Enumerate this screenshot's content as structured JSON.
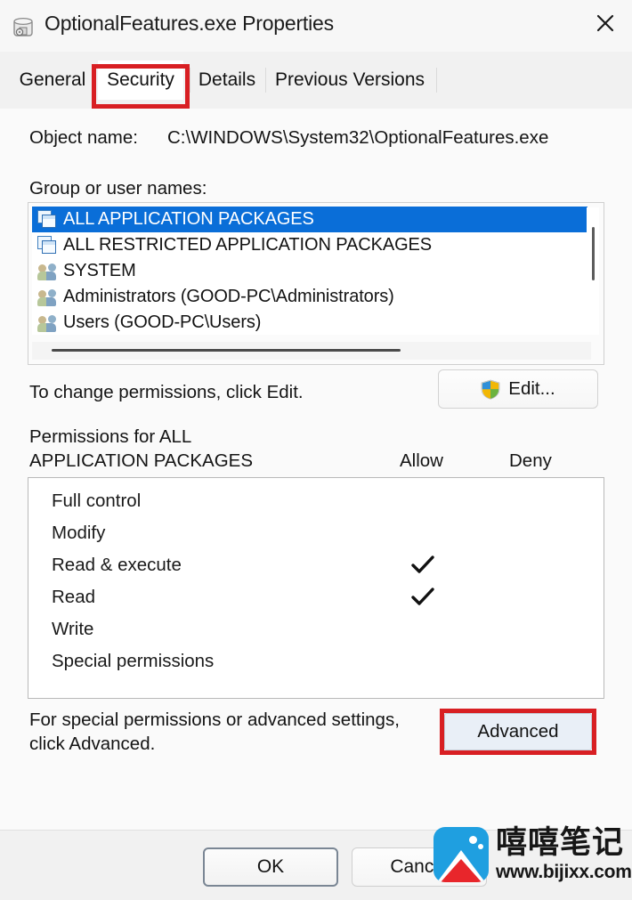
{
  "window": {
    "title": "OptionalFeatures.exe Properties",
    "app_icon": "windows-features-icon",
    "close_label": "✕"
  },
  "tabs": [
    {
      "label": "General",
      "active": false
    },
    {
      "label": "Security",
      "active": true
    },
    {
      "label": "Details",
      "active": false
    },
    {
      "label": "Previous Versions",
      "active": false
    }
  ],
  "security": {
    "object_name_label": "Object name:",
    "object_name_value": "C:\\WINDOWS\\System32\\OptionalFeatures.exe",
    "group_label": "Group or user names:",
    "users": [
      {
        "name": "ALL APPLICATION PACKAGES",
        "icon": "package-icon",
        "selected": true
      },
      {
        "name": "ALL RESTRICTED APPLICATION PACKAGES",
        "icon": "package-icon",
        "selected": false
      },
      {
        "name": "SYSTEM",
        "icon": "group-icon",
        "selected": false
      },
      {
        "name": "Administrators (GOOD-PC\\Administrators)",
        "icon": "group-icon",
        "selected": false
      },
      {
        "name": "Users (GOOD-PC\\Users)",
        "icon": "group-icon",
        "selected": false
      }
    ],
    "edit_hint": "To change permissions, click Edit.",
    "edit_button_label": "Edit...",
    "permissions_for_line1": "Permissions for ALL",
    "permissions_for_line2": "APPLICATION PACKAGES",
    "allow_header": "Allow",
    "deny_header": "Deny",
    "permissions": [
      {
        "name": "Full control",
        "allow": false,
        "deny": false
      },
      {
        "name": "Modify",
        "allow": false,
        "deny": false
      },
      {
        "name": "Read & execute",
        "allow": true,
        "deny": false
      },
      {
        "name": "Read",
        "allow": true,
        "deny": false
      },
      {
        "name": "Write",
        "allow": false,
        "deny": false
      },
      {
        "name": "Special permissions",
        "allow": false,
        "deny": false
      }
    ],
    "check_glyph": "✓",
    "advanced_hint_line1": "For special permissions or advanced settings,",
    "advanced_hint_line2": "click Advanced.",
    "advanced_button_label": "Advanced"
  },
  "footer": {
    "ok_label": "OK",
    "cancel_label": "Cancel"
  },
  "watermark": {
    "brand_cn": "嘻嘻笔记",
    "url": "www.bijixx.com"
  },
  "colors": {
    "selection_blue": "#0a6ed8",
    "annotation_red": "#d81f23",
    "advanced_fill": "#e9eff7"
  }
}
